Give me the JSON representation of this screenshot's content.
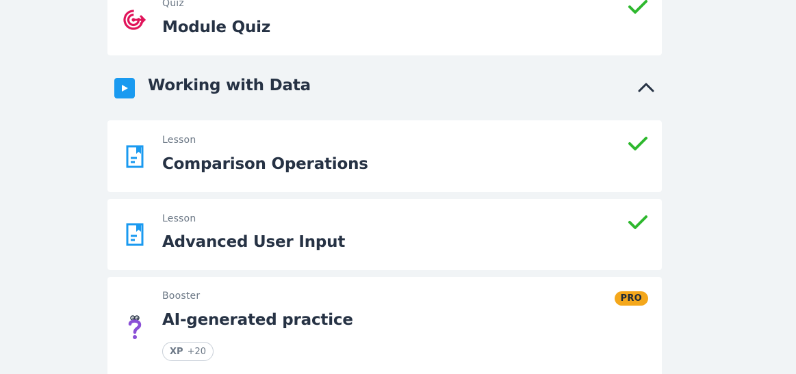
{
  "quiz_card": {
    "type_label": "Quiz",
    "title": "Module Quiz",
    "completed": true,
    "icon": "target-icon",
    "icon_color": "#e0145a"
  },
  "section": {
    "title": "Working with Data",
    "expanded": true,
    "icon": "play-icon",
    "icon_color": "#1a9af0"
  },
  "lessons": [
    {
      "type_label": "Lesson",
      "title": "Comparison Operations",
      "completed": true,
      "icon": "lesson-document-icon"
    },
    {
      "type_label": "Lesson",
      "title": "Advanced User Input",
      "completed": true,
      "icon": "lesson-document-icon"
    }
  ],
  "booster_card": {
    "type_label": "Booster",
    "title": "AI-generated practice",
    "badge": "PRO",
    "xp_label": "XP",
    "xp_value": "+20",
    "icon": "question-mark-character-icon",
    "icon_color": "#8a4fd6"
  },
  "colors": {
    "check_green": "#2eb82e",
    "lesson_icon_blue": "#1a9af0",
    "pro_badge": "#f4a71b",
    "background": "#f1f4f6"
  }
}
